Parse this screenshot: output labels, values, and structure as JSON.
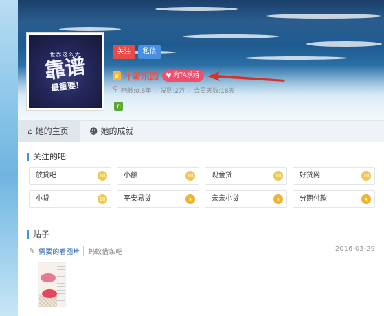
{
  "profile": {
    "follow_label": "关注",
    "message_label": "私信",
    "username": "叶雪乐园",
    "propose_label": "向TA求婚",
    "bar_age": "吧龄:0.8年",
    "post_count": "发贴:2万",
    "member_days": "会员天数:18天",
    "avatar_lines": [
      "世界这么大",
      "靠谱",
      "最重要!"
    ],
    "badge_text": "Yi"
  },
  "tabs": [
    {
      "label": "她的主页",
      "icon": "home-icon",
      "active": true
    },
    {
      "label": "她的成就",
      "icon": "user-icon",
      "active": false
    }
  ],
  "followed_bars": {
    "title": "关注的吧",
    "items": [
      {
        "name": "放贷吧",
        "level_icon": "level-badge"
      },
      {
        "name": "小额",
        "level_icon": "level-badge"
      },
      {
        "name": "现金贷",
        "level_icon": "level-badge"
      },
      {
        "name": "好贷网",
        "level_icon": "level-badge"
      },
      {
        "name": "小贷",
        "level_icon": "level-badge"
      },
      {
        "name": "平安易贷",
        "level_icon": "star-badge"
      },
      {
        "name": "亲亲小贷",
        "level_icon": "star-badge"
      },
      {
        "name": "分期付款",
        "level_icon": "star-badge"
      }
    ]
  },
  "posts": {
    "title": "贴子",
    "items": [
      {
        "title": "需要的看图片",
        "forum": "蚂蚁借条吧",
        "date": "2016-03-29"
      }
    ]
  },
  "colors": {
    "accent_red": "#e84a48",
    "accent_blue": "#4a90e2",
    "propose_pink": "#ee4f6c",
    "link_blue": "#2d64b3"
  }
}
